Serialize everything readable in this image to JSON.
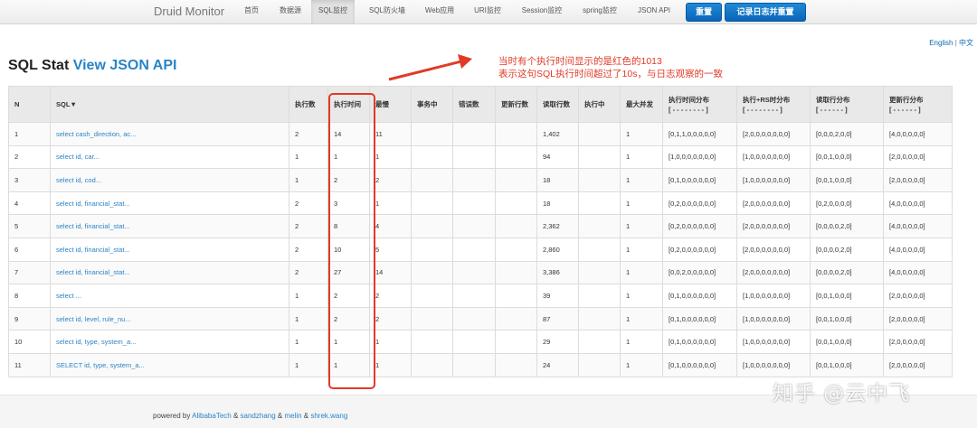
{
  "nav": {
    "brand": "Druid Monitor",
    "items": [
      {
        "label": "首页",
        "active": false
      },
      {
        "label": "数据源",
        "active": false
      },
      {
        "label": "SQL监控",
        "active": true
      },
      {
        "label": "SQL防火墙",
        "active": false
      },
      {
        "label": "Web应用",
        "active": false
      },
      {
        "label": "URI监控",
        "active": false
      },
      {
        "label": "Session监控",
        "active": false
      },
      {
        "label": "spring监控",
        "active": false
      },
      {
        "label": "JSON API",
        "active": false
      }
    ],
    "reset_label": "重置",
    "log_reset_label": "记录日志并重置"
  },
  "lang": {
    "english": "English",
    "sep": " | ",
    "chinese": "中文"
  },
  "title": {
    "text": "SQL Stat ",
    "link": "View JSON API"
  },
  "annotation": {
    "line1": "当时有个执行时间显示的是红色的1013",
    "line2": "表示这句SQL执行时间超过了10s，与日志观察的一致",
    "color": "#e13a27"
  },
  "table": {
    "headers": [
      "N",
      "SQL▼",
      "执行数",
      "执行时间",
      "最慢",
      "事务中",
      "错误数",
      "更新行数",
      "读取行数",
      "执行中",
      "最大并发",
      "执行时间分布",
      "执行+RS时分布",
      "读取行分布",
      "更新行分布"
    ],
    "header_subs": {
      "11": "[ - - - - - - - - ]",
      "12": "[ - - - - - - - - ]",
      "13": "[ - - - - - - ]",
      "14": "[ - - - - - - ]"
    },
    "rows": [
      [
        "1",
        "select cash_direction, ac...",
        "2",
        "14",
        "11",
        "",
        "",
        "",
        "1,402",
        "",
        "1",
        "[0,1,1,0,0,0,0,0]",
        "[2,0,0,0,0,0,0,0]",
        "[0,0,0,2,0,0]",
        "[4,0,0,0,0,0]"
      ],
      [
        "2",
        "select id, car...",
        "1",
        "1",
        "1",
        "",
        "",
        "",
        "94",
        "",
        "1",
        "[1,0,0,0,0,0,0,0]",
        "[1,0,0,0,0,0,0,0]",
        "[0,0,1,0,0,0]",
        "[2,0,0,0,0,0]"
      ],
      [
        "3",
        "select id, cod...",
        "1",
        "2",
        "2",
        "",
        "",
        "",
        "18",
        "",
        "1",
        "[0,1,0,0,0,0,0,0]",
        "[1,0,0,0,0,0,0,0]",
        "[0,0,1,0,0,0]",
        "[2,0,0,0,0,0]"
      ],
      [
        "4",
        "select id, financial_stat...",
        "2",
        "3",
        "1",
        "",
        "",
        "",
        "18",
        "",
        "1",
        "[0,2,0,0,0,0,0,0]",
        "[2,0,0,0,0,0,0,0]",
        "[0,2,0,0,0,0]",
        "[4,0,0,0,0,0]"
      ],
      [
        "5",
        "select id, financial_stat...",
        "2",
        "8",
        "4",
        "",
        "",
        "",
        "2,362",
        "",
        "1",
        "[0,2,0,0,0,0,0,0]",
        "[2,0,0,0,0,0,0,0]",
        "[0,0,0,0,2,0]",
        "[4,0,0,0,0,0]"
      ],
      [
        "6",
        "select id, financial_stat...",
        "2",
        "10",
        "5",
        "",
        "",
        "",
        "2,860",
        "",
        "1",
        "[0,2,0,0,0,0,0,0]",
        "[2,0,0,0,0,0,0,0]",
        "[0,0,0,0,2,0]",
        "[4,0,0,0,0,0]"
      ],
      [
        "7",
        "select id, financial_stat...",
        "2",
        "27",
        "14",
        "",
        "",
        "",
        "3,386",
        "",
        "1",
        "[0,0,2,0,0,0,0,0]",
        "[2,0,0,0,0,0,0,0]",
        "[0,0,0,0,2,0]",
        "[4,0,0,0,0,0]"
      ],
      [
        "8",
        "select ...",
        "1",
        "2",
        "2",
        "",
        "",
        "",
        "39",
        "",
        "1",
        "[0,1,0,0,0,0,0,0]",
        "[1,0,0,0,0,0,0,0]",
        "[0,0,1,0,0,0]",
        "[2,0,0,0,0,0]"
      ],
      [
        "9",
        "select id, level, rule_nu...",
        "1",
        "2",
        "2",
        "",
        "",
        "",
        "87",
        "",
        "1",
        "[0,1,0,0,0,0,0,0]",
        "[1,0,0,0,0,0,0,0]",
        "[0,0,1,0,0,0]",
        "[2,0,0,0,0,0]"
      ],
      [
        "10",
        "select id, type, system_a...",
        "1",
        "1",
        "1",
        "",
        "",
        "",
        "29",
        "",
        "1",
        "[0,1,0,0,0,0,0,0]",
        "[1,0,0,0,0,0,0,0]",
        "[0,0,1,0,0,0]",
        "[2,0,0,0,0,0]"
      ],
      [
        "11",
        "SELECT id, type, system_a...",
        "1",
        "1",
        "1",
        "",
        "",
        "",
        "24",
        "",
        "1",
        "[0,1,0,0,0,0,0,0]",
        "[1,0,0,0,0,0,0,0]",
        "[0,0,1,0,0,0]",
        "[2,0,0,0,0,0]"
      ]
    ]
  },
  "footer": {
    "prefix": "powered by ",
    "authors": [
      "AlibabaTech",
      "sandzhang",
      "melin",
      "shrek.wang"
    ],
    "sep": " & "
  },
  "watermark": "知乎 @云中飞"
}
